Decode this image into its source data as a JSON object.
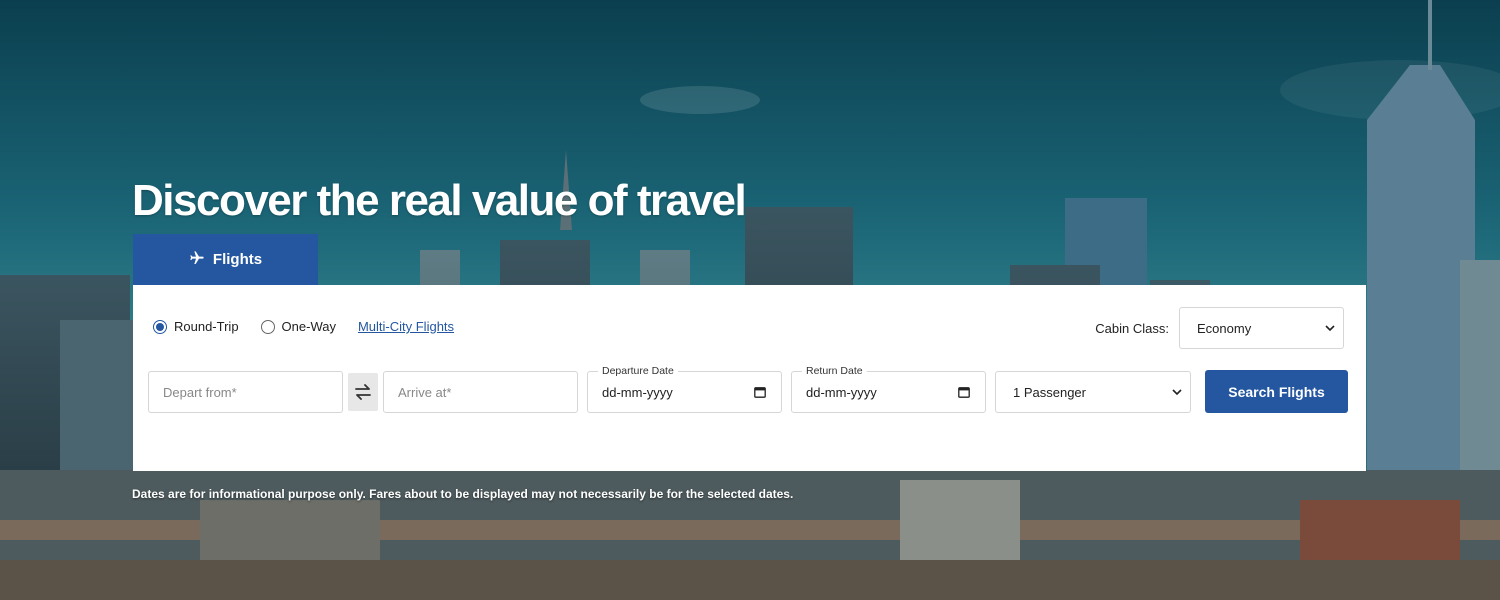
{
  "hero": {
    "title": "Discover the real value of travel"
  },
  "tabs": {
    "flights_label": "Flights",
    "flights_icon": "airplane-icon"
  },
  "trip_type": {
    "options": [
      "Round-Trip",
      "One-Way"
    ],
    "selected": "Round-Trip",
    "multi_city_link": "Multi-City Flights"
  },
  "cabin": {
    "label": "Cabin Class:",
    "selected": "Economy"
  },
  "fields": {
    "depart_placeholder": "Depart from*",
    "arrive_placeholder": "Arrive at*",
    "departure_date_label": "Departure Date",
    "departure_date_value": "dd-mm-yyyy",
    "return_date_label": "Return Date",
    "return_date_value": "dd-mm-yyyy",
    "passengers_selected": "1 Passenger"
  },
  "actions": {
    "search_label": "Search Flights"
  },
  "disclaimer": "Dates are for informational purpose only. Fares about to be displayed may not necessarily be for the selected dates.",
  "colors": {
    "accent": "#2457a0",
    "sky_top": "#0b4455",
    "sky_mid": "#1d6b7c"
  }
}
